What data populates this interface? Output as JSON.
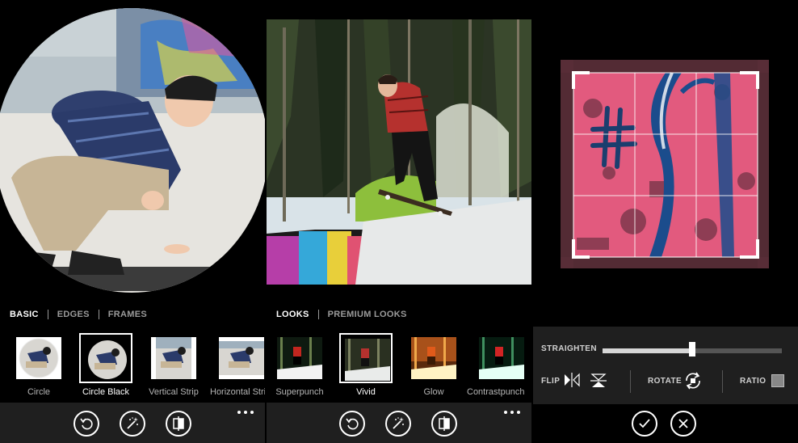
{
  "panel1": {
    "tabs": [
      "BASIC",
      "EDGES",
      "FRAMES"
    ],
    "active_tab": 0,
    "thumbnails": [
      {
        "label": "Circle"
      },
      {
        "label": "Circle Black"
      },
      {
        "label": "Vertical Strip"
      },
      {
        "label": "Horizontal Stri"
      }
    ],
    "selected_thumbnail": 1,
    "toolbar_icons": [
      "undo-icon",
      "magic-wand-icon",
      "compare-icon",
      "more-icon"
    ]
  },
  "panel2": {
    "tabs": [
      "LOOKS",
      "PREMIUM LOOKS"
    ],
    "active_tab": 0,
    "thumbnails": [
      {
        "label": "Superpunch"
      },
      {
        "label": "Vivid"
      },
      {
        "label": "Glow"
      },
      {
        "label": "Contrastpunch"
      }
    ],
    "selected_thumbnail": 1,
    "toolbar_icons": [
      "undo-icon",
      "magic-wand-icon",
      "compare-icon",
      "more-icon"
    ]
  },
  "panel3": {
    "straighten_label": "STRAIGHTEN",
    "straighten_value": 0.5,
    "flip_label": "FLIP",
    "rotate_label": "ROTATE",
    "ratio_label": "RATIO",
    "confirm_icons": [
      "check-icon",
      "close-icon"
    ]
  },
  "colors": {
    "background": "#000000",
    "toolbar": "#1f1f1f",
    "inactive_tab": "#9a9a9a",
    "graffiti_pink": "#e25a7e"
  }
}
